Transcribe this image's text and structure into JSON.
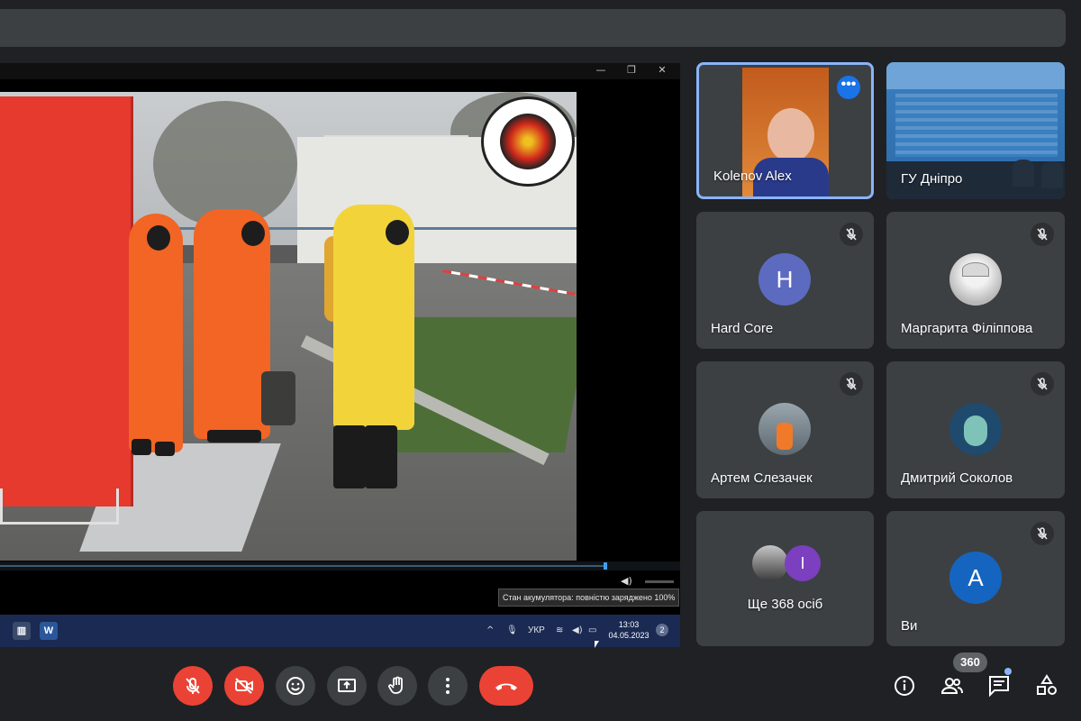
{
  "presentation": {
    "window_buttons": {
      "minimize": "—",
      "restore": "❐",
      "close": "✕"
    },
    "tooltip": "Стан акумулятора: повністю заряджено 100%",
    "taskbar": {
      "lang": "УКР",
      "time": "13:03",
      "date": "04.05.2023",
      "notification_count": "2",
      "word_icon_label": "W"
    },
    "playback_progress": 0.89
  },
  "participants": [
    {
      "name": "Kolenov Alex",
      "type": "video",
      "active": true,
      "menu": "•••"
    },
    {
      "name": "ГУ Дніпро",
      "type": "video"
    },
    {
      "name": "Hard Core",
      "initial": "H",
      "color": "#5c6bc0",
      "muted": true
    },
    {
      "name": "Маргарита Філіппова",
      "type": "avatar",
      "muted": true
    },
    {
      "name": "Артем Слезачек",
      "type": "avatar",
      "muted": true
    },
    {
      "name": "Дмитрий Соколов",
      "type": "avatar",
      "muted": true
    },
    {
      "name": "Ще 368 осіб",
      "type": "group",
      "initial": "I",
      "color": "#7b3fbf"
    },
    {
      "name": "Ви",
      "initial": "A",
      "color": "#1565c0",
      "muted": true
    }
  ],
  "controls": {
    "participants_count": "360",
    "icons": [
      "mic-off-icon",
      "camera-off-icon",
      "emoji-icon",
      "present-icon",
      "raise-hand-icon",
      "more-options-icon",
      "hang-up-icon",
      "info-icon",
      "people-icon",
      "chat-icon",
      "activities-icon"
    ],
    "colors": {
      "danger": "#ea4335",
      "surface": "#3c4043",
      "accent": "#8ab4f8"
    }
  }
}
